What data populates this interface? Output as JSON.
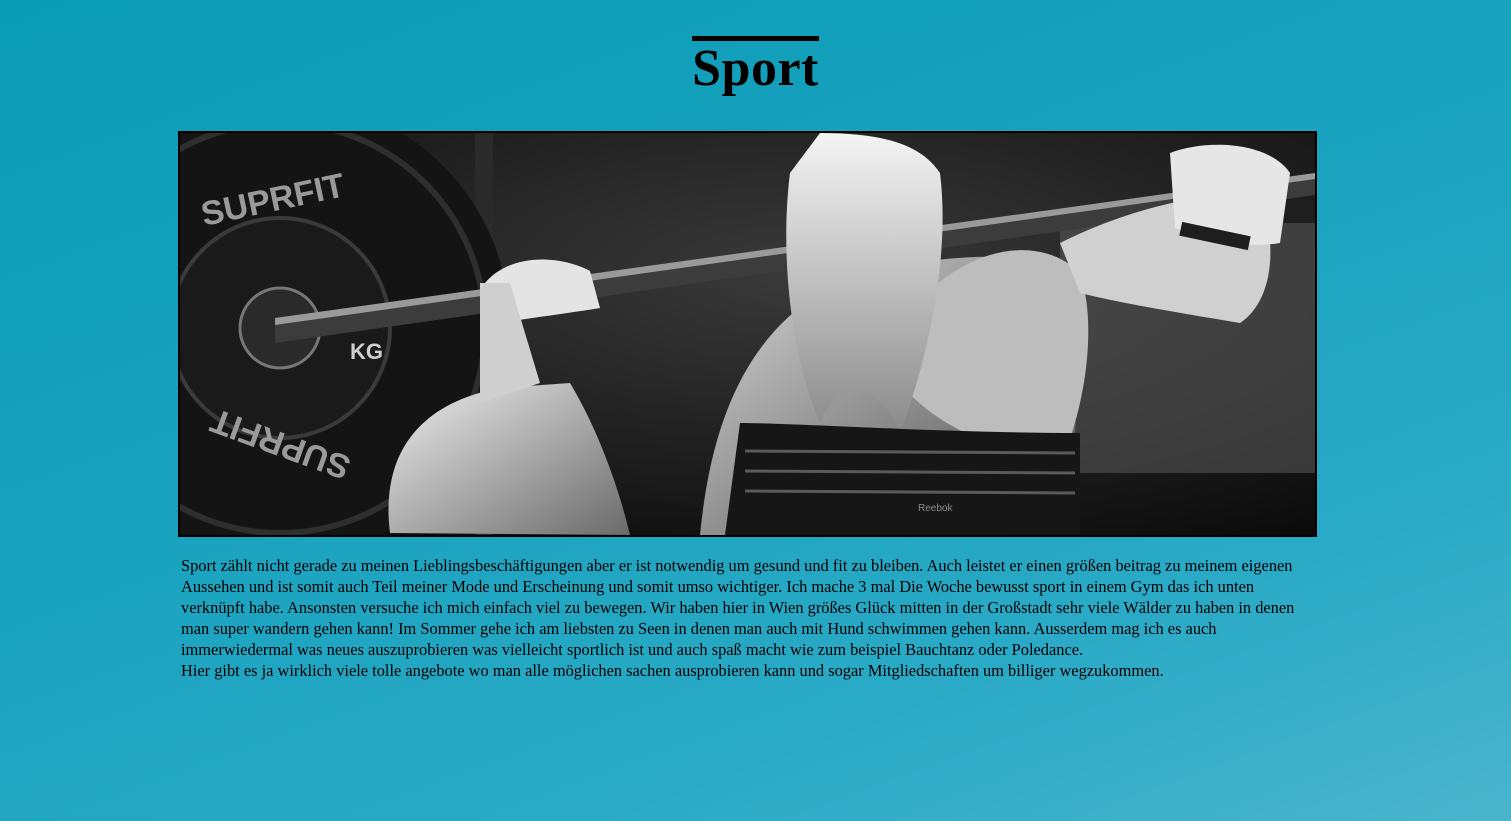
{
  "page": {
    "title": "Sport",
    "background_color": "#1aa3bf"
  },
  "hero_image": {
    "description_icon": "weightlifting-photo",
    "plate_text_top": "SUPRFIT",
    "plate_text_bottom": "SUPRFIT",
    "plate_unit": "KG"
  },
  "content": {
    "paragraph_1": "Sport zählt nicht gerade zu meinen Lieblingsbeschäftigungen aber er ist notwendig um gesund und fit zu bleiben. Auch leistet er einen größen beitrag zu meinem eigenen Aussehen und ist somit auch Teil meiner Mode und Erscheinung und somit umso wichtiger. Ich mache 3 mal Die Woche bewusst sport in einem Gym das ich unten verknüpft habe. Ansonsten versuche ich mich einfach viel zu bewegen. Wir haben hier in Wien größes Glück mitten in der Großstadt sehr viele Wälder zu haben in denen man super wandern gehen kann! Im Sommer gehe ich am liebsten zu Seen in denen man auch mit Hund schwimmen gehen kann. Ausserdem mag ich es auch immerwiedermal was neues auszuprobieren was vielleicht sportlich ist und auch spaß macht wie zum beispiel Bauchtanz oder Poledance.",
    "paragraph_2": "Hier gibt es ja wirklich viele tolle angebote wo man alle möglichen sachen ausprobieren kann und sogar Mitgliedschaften um billiger wegzukommen."
  }
}
